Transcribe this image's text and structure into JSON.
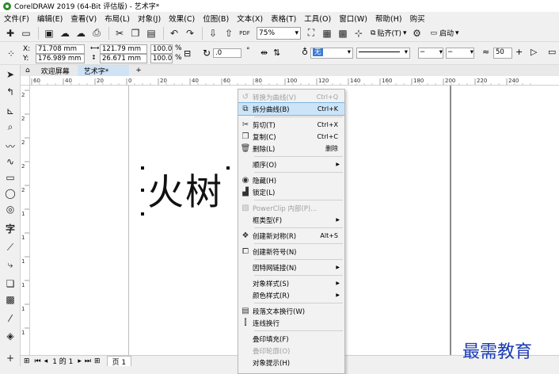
{
  "window": {
    "title": "CorelDRAW 2019 (64-Bit 评估版) - 艺术字*"
  },
  "menu": [
    "文件(F)",
    "编辑(E)",
    "查看(V)",
    "布局(L)",
    "对象(J)",
    "效果(C)",
    "位图(B)",
    "文本(X)",
    "表格(T)",
    "工具(O)",
    "窗口(W)",
    "帮助(H)",
    "购买"
  ],
  "toolbar": {
    "zoom": "75%",
    "snap_label": "贴齐(T)",
    "launch_label": "启动",
    "pdf_label": "PDF"
  },
  "properties": {
    "x_label": "X:",
    "y_label": "Y:",
    "x": "71.708 mm",
    "y": "176.989 mm",
    "width": "121.79 mm",
    "height": "26.671 mm",
    "scale_x": "100.0",
    "scale_y": "100.0",
    "percent": "%",
    "rotation": ".0",
    "degree": "°",
    "fill_value": "无",
    "size_value": "50"
  },
  "doc_tabs": [
    {
      "label": "欢迎屏幕"
    },
    {
      "label": "艺术字*"
    }
  ],
  "ruler": {
    "h": [
      "60",
      "40",
      "20",
      "0",
      "20",
      "40",
      "60",
      "80",
      "100",
      "120",
      "140",
      "160",
      "180",
      "200",
      "220",
      "240"
    ],
    "v": [
      "2",
      "2",
      "2",
      "2",
      "2",
      "1",
      "1",
      "1",
      "1",
      "1",
      "1"
    ]
  },
  "canvas": {
    "art_text": "火树"
  },
  "context_menu": {
    "items": [
      {
        "label": "转换为曲线(V)",
        "shortcut": "Ctrl+Q"
      },
      {
        "label": "拆分曲线(B)",
        "shortcut": "Ctrl+K"
      },
      {
        "label": "剪切(T)",
        "shortcut": "Ctrl+X"
      },
      {
        "label": "复制(C)",
        "shortcut": "Ctrl+C"
      },
      {
        "label": "删除(L)",
        "shortcut": "删除"
      },
      {
        "label": "顺序(O)",
        "shortcut": ""
      },
      {
        "label": "隐藏(H)",
        "shortcut": ""
      },
      {
        "label": "锁定(L)",
        "shortcut": ""
      },
      {
        "label": "PowerClip 内部(P)...",
        "shortcut": ""
      },
      {
        "label": "框类型(F)",
        "shortcut": ""
      },
      {
        "label": "创建新对称(R)",
        "shortcut": "Alt+S"
      },
      {
        "label": "创建新符号(N)",
        "shortcut": ""
      },
      {
        "label": "因特网链接(N)",
        "shortcut": ""
      },
      {
        "label": "对象样式(S)",
        "shortcut": ""
      },
      {
        "label": "颜色样式(R)",
        "shortcut": ""
      },
      {
        "label": "段落文本换行(W)",
        "shortcut": ""
      },
      {
        "label": "连线换行",
        "shortcut": ""
      },
      {
        "label": "叠印填充(F)",
        "shortcut": ""
      },
      {
        "label": "叠印轮廓(O)",
        "shortcut": ""
      },
      {
        "label": "对象提示(H)",
        "shortcut": ""
      }
    ]
  },
  "pager": {
    "page_status": "1 的 1",
    "page_tab": "页 1"
  },
  "watermark": "最需教育"
}
